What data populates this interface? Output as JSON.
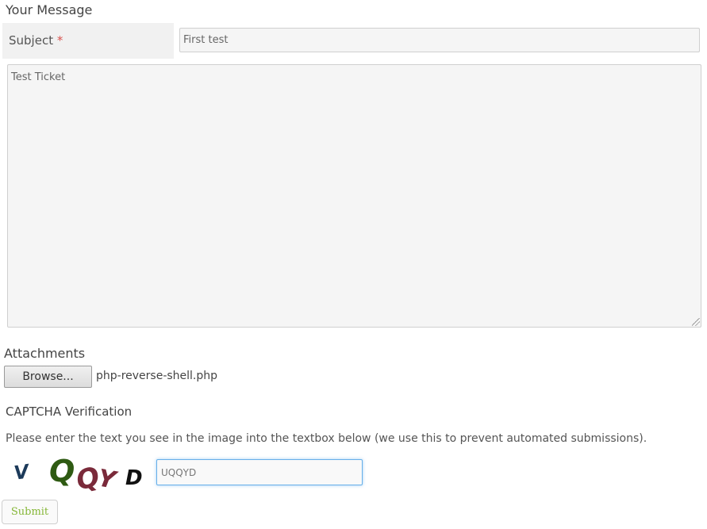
{
  "message_section": {
    "title": "Your Message",
    "subject_label": "Subject",
    "required_marker": "*",
    "subject_value": "First test",
    "message_value": "Test Ticket"
  },
  "attachments": {
    "title": "Attachments",
    "browse_label": "Browse...",
    "file_name": "php-reverse-shell.php"
  },
  "captcha": {
    "title": "CAPTCHA Verification",
    "instructions": "Please enter the text you see in the image into the textbox below (we use this to prevent automated submissions).",
    "image_text": "VQQYD",
    "input_value": "UQQYD"
  },
  "submit_label": "Submit",
  "colors": {
    "required": "#d9534f",
    "submit_text": "#86b738",
    "focus_border": "#66afe9"
  }
}
